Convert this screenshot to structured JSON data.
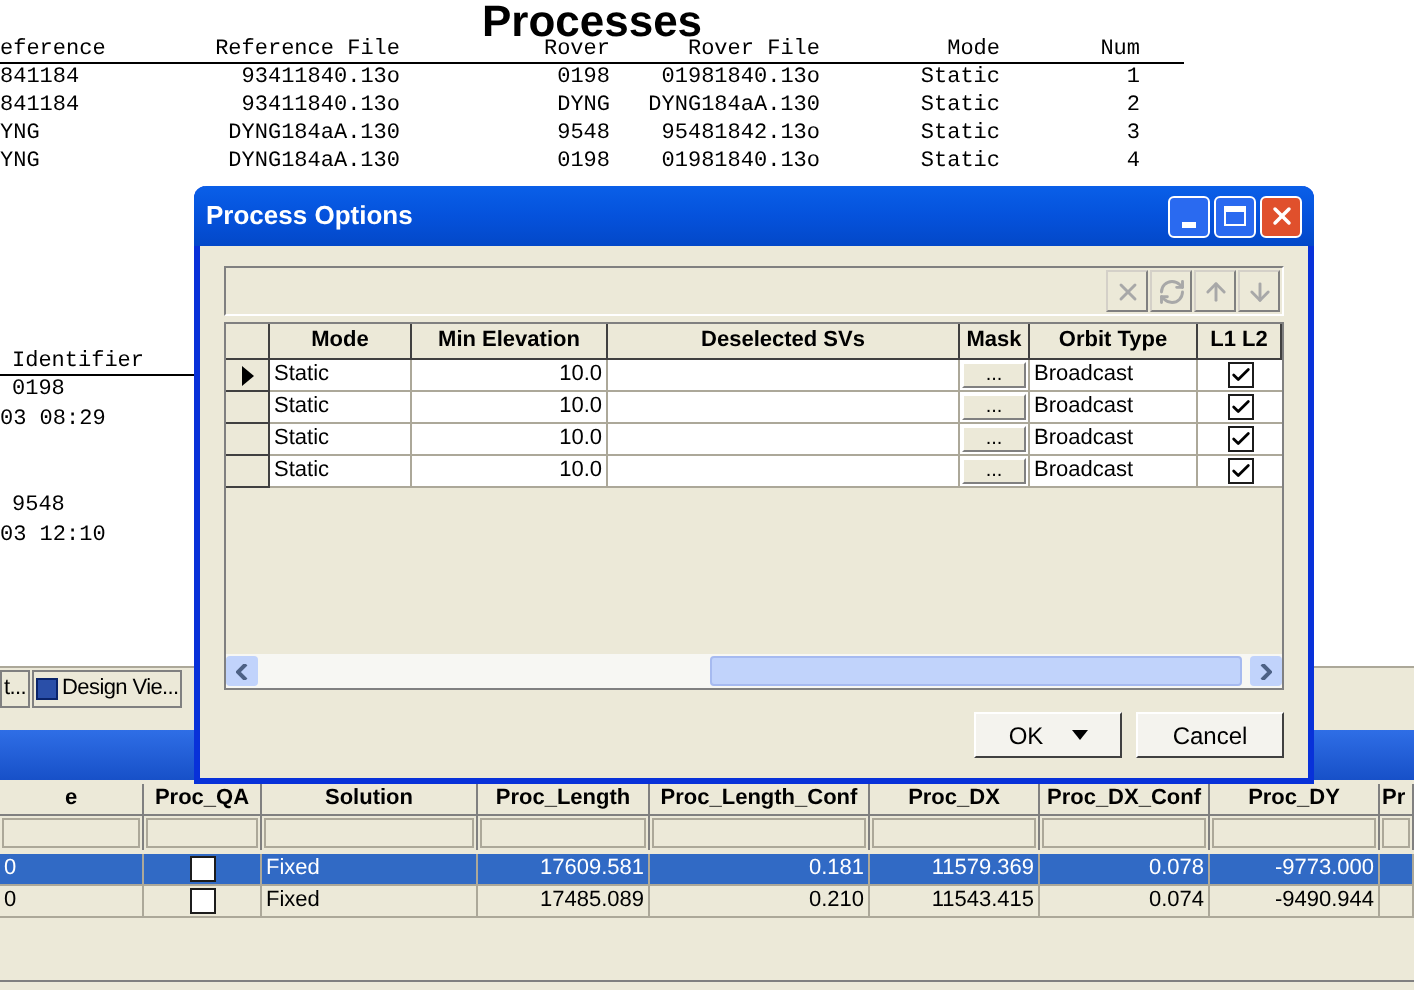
{
  "report": {
    "title": "Processes",
    "columns": [
      "eference",
      "Reference File",
      "Rover",
      "Rover File",
      "Mode",
      "Num"
    ],
    "rows": [
      [
        "841184",
        "93411840.13o",
        "0198",
        "01981840.13o",
        "Static",
        "1"
      ],
      [
        "841184",
        "93411840.13o",
        "DYNG",
        "DYNG184aA.130",
        "Static",
        "2"
      ],
      [
        "YNG",
        "DYNG184aA.130",
        "9548",
        "95481842.13o",
        "Static",
        "3"
      ],
      [
        "YNG",
        "DYNG184aA.130",
        "0198",
        "01981840.13o",
        "Static",
        "4"
      ]
    ]
  },
  "identifier": {
    "header": "Identifier",
    "records": [
      {
        "lines": [
          "0198",
          "03 08:29"
        ]
      },
      {
        "lines": [
          "9548",
          "03 12:10"
        ]
      }
    ]
  },
  "tabs": [
    {
      "label": "t...",
      "selected": false
    },
    {
      "label": "Design Vie...",
      "selected": false
    }
  ],
  "grid": {
    "columns": [
      "e",
      "Proc_QA",
      "Solution",
      "Proc_Length",
      "Proc_Length_Conf",
      "Proc_DX",
      "Proc_DX_Conf",
      "Proc_DY",
      "Pr"
    ],
    "rows": [
      {
        "selected": true,
        "qa_checked": false,
        "cells": [
          "0",
          "",
          "Fixed",
          "17609.581",
          "0.181",
          "11579.369",
          "0.078",
          "-9773.000"
        ]
      },
      {
        "selected": false,
        "qa_checked": false,
        "cells": [
          "0",
          "",
          "Fixed",
          "17485.089",
          "0.210",
          "11543.415",
          "0.074",
          "-9490.944"
        ]
      }
    ]
  },
  "dialog": {
    "title": "Process Options",
    "toolbar": [
      {
        "kind": "delete",
        "disabled": true
      },
      {
        "kind": "refresh",
        "disabled": true
      },
      {
        "kind": "up",
        "disabled": true
      },
      {
        "kind": "down",
        "disabled": true
      }
    ],
    "columns": [
      "Mode",
      "Min Elevation",
      "Deselected SVs",
      "Mask",
      "Orbit Type",
      "L1 L2"
    ],
    "rows": [
      {
        "current": true,
        "mode": "Static",
        "min_elevation": "10.0",
        "mask": "...",
        "orbit_type": "Broadcast",
        "l1l2": true
      },
      {
        "current": false,
        "mode": "Static",
        "min_elevation": "10.0",
        "mask": "...",
        "orbit_type": "Broadcast",
        "l1l2": true
      },
      {
        "current": false,
        "mode": "Static",
        "min_elevation": "10.0",
        "mask": "...",
        "orbit_type": "Broadcast",
        "l1l2": true
      },
      {
        "current": false,
        "mode": "Static",
        "min_elevation": "10.0",
        "mask": "...",
        "orbit_type": "Broadcast",
        "l1l2": true
      }
    ],
    "buttons": [
      {
        "label": "OK",
        "dropdown": true
      },
      {
        "label": "Cancel",
        "dropdown": false
      }
    ]
  }
}
